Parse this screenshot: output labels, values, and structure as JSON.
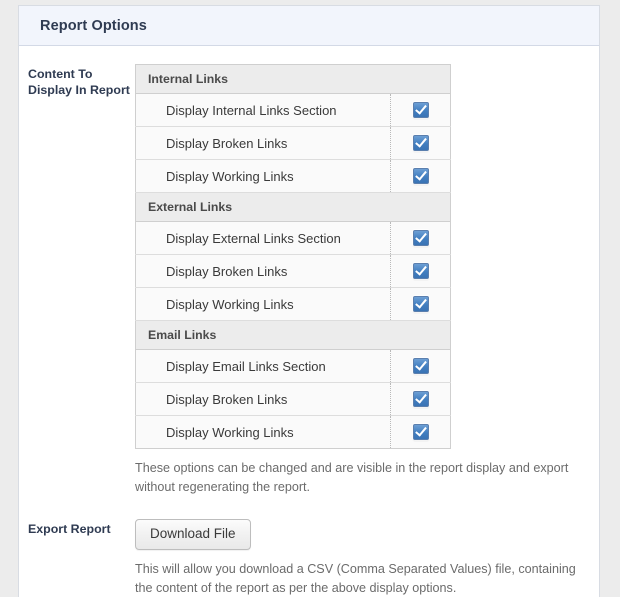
{
  "panel": {
    "title": "Report Options"
  },
  "fields": {
    "content_label": "Content To Display In Report",
    "export_label": "Export Report"
  },
  "options_table": {
    "sections": [
      {
        "heading": "Internal Links",
        "rows": [
          {
            "label": "Display Internal Links Section",
            "checked": true
          },
          {
            "label": "Display Broken Links",
            "checked": true
          },
          {
            "label": "Display Working Links",
            "checked": true
          }
        ]
      },
      {
        "heading": "External Links",
        "rows": [
          {
            "label": "Display External Links Section",
            "checked": true
          },
          {
            "label": "Display Broken Links",
            "checked": true
          },
          {
            "label": "Display Working Links",
            "checked": true
          }
        ]
      },
      {
        "heading": "Email Links",
        "rows": [
          {
            "label": "Display Email Links Section",
            "checked": true
          },
          {
            "label": "Display Broken Links",
            "checked": true
          },
          {
            "label": "Display Working Links",
            "checked": true
          }
        ]
      }
    ]
  },
  "help": {
    "options_note": "These options can be changed and are visible in the report display and export without regenerating the report.",
    "export_note": "This will allow you download a CSV (Comma Separated Values) file, containing the content of the report as per the above display options."
  },
  "buttons": {
    "download": "Download File"
  },
  "colors": {
    "header_bg": "#f2f5fc",
    "label_text": "#2f3b52",
    "section_bg": "#ececec",
    "row_bg": "#fafafa",
    "checkbox_blue": "#417ec0",
    "page_bg": "#ececec"
  }
}
